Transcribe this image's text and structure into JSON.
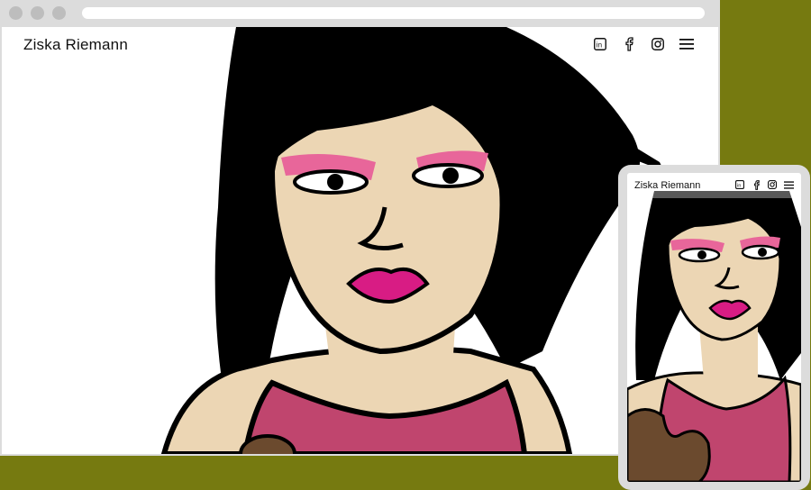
{
  "site": {
    "title": "Ziska Riemann"
  },
  "nav": {
    "icons": [
      "linkedin-icon",
      "facebook-icon",
      "instagram-icon",
      "menu-icon"
    ]
  },
  "mobile": {
    "title": "Ziska Riemann"
  },
  "colors": {
    "background": "#767a10",
    "frame": "#dcdcdc",
    "skin": "#ecd6b4",
    "hair": "#000000",
    "shirt": "#c0456e",
    "eyeshadow": "#e8669a",
    "lips": "#d81c84",
    "bear": "#6b4a2e"
  }
}
